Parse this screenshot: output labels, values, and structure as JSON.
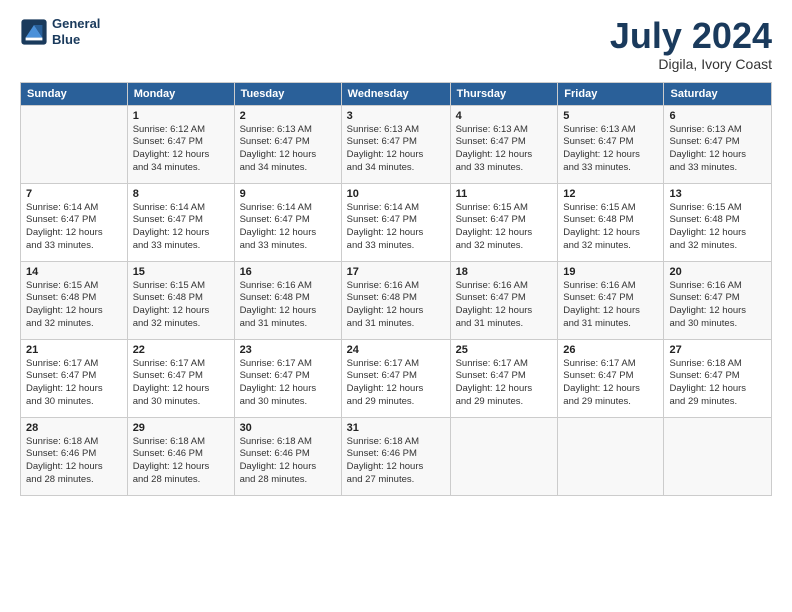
{
  "logo": {
    "line1": "General",
    "line2": "Blue"
  },
  "title": "July 2024",
  "subtitle": "Digila, Ivory Coast",
  "days_of_week": [
    "Sunday",
    "Monday",
    "Tuesday",
    "Wednesday",
    "Thursday",
    "Friday",
    "Saturday"
  ],
  "weeks": [
    [
      {
        "day": "",
        "info": ""
      },
      {
        "day": "1",
        "info": "Sunrise: 6:12 AM\nSunset: 6:47 PM\nDaylight: 12 hours\nand 34 minutes."
      },
      {
        "day": "2",
        "info": "Sunrise: 6:13 AM\nSunset: 6:47 PM\nDaylight: 12 hours\nand 34 minutes."
      },
      {
        "day": "3",
        "info": "Sunrise: 6:13 AM\nSunset: 6:47 PM\nDaylight: 12 hours\nand 34 minutes."
      },
      {
        "day": "4",
        "info": "Sunrise: 6:13 AM\nSunset: 6:47 PM\nDaylight: 12 hours\nand 33 minutes."
      },
      {
        "day": "5",
        "info": "Sunrise: 6:13 AM\nSunset: 6:47 PM\nDaylight: 12 hours\nand 33 minutes."
      },
      {
        "day": "6",
        "info": "Sunrise: 6:13 AM\nSunset: 6:47 PM\nDaylight: 12 hours\nand 33 minutes."
      }
    ],
    [
      {
        "day": "7",
        "info": "Sunrise: 6:14 AM\nSunset: 6:47 PM\nDaylight: 12 hours\nand 33 minutes."
      },
      {
        "day": "8",
        "info": "Sunrise: 6:14 AM\nSunset: 6:47 PM\nDaylight: 12 hours\nand 33 minutes."
      },
      {
        "day": "9",
        "info": "Sunrise: 6:14 AM\nSunset: 6:47 PM\nDaylight: 12 hours\nand 33 minutes."
      },
      {
        "day": "10",
        "info": "Sunrise: 6:14 AM\nSunset: 6:47 PM\nDaylight: 12 hours\nand 33 minutes."
      },
      {
        "day": "11",
        "info": "Sunrise: 6:15 AM\nSunset: 6:47 PM\nDaylight: 12 hours\nand 32 minutes."
      },
      {
        "day": "12",
        "info": "Sunrise: 6:15 AM\nSunset: 6:48 PM\nDaylight: 12 hours\nand 32 minutes."
      },
      {
        "day": "13",
        "info": "Sunrise: 6:15 AM\nSunset: 6:48 PM\nDaylight: 12 hours\nand 32 minutes."
      }
    ],
    [
      {
        "day": "14",
        "info": "Sunrise: 6:15 AM\nSunset: 6:48 PM\nDaylight: 12 hours\nand 32 minutes."
      },
      {
        "day": "15",
        "info": "Sunrise: 6:15 AM\nSunset: 6:48 PM\nDaylight: 12 hours\nand 32 minutes."
      },
      {
        "day": "16",
        "info": "Sunrise: 6:16 AM\nSunset: 6:48 PM\nDaylight: 12 hours\nand 31 minutes."
      },
      {
        "day": "17",
        "info": "Sunrise: 6:16 AM\nSunset: 6:48 PM\nDaylight: 12 hours\nand 31 minutes."
      },
      {
        "day": "18",
        "info": "Sunrise: 6:16 AM\nSunset: 6:47 PM\nDaylight: 12 hours\nand 31 minutes."
      },
      {
        "day": "19",
        "info": "Sunrise: 6:16 AM\nSunset: 6:47 PM\nDaylight: 12 hours\nand 31 minutes."
      },
      {
        "day": "20",
        "info": "Sunrise: 6:16 AM\nSunset: 6:47 PM\nDaylight: 12 hours\nand 30 minutes."
      }
    ],
    [
      {
        "day": "21",
        "info": "Sunrise: 6:17 AM\nSunset: 6:47 PM\nDaylight: 12 hours\nand 30 minutes."
      },
      {
        "day": "22",
        "info": "Sunrise: 6:17 AM\nSunset: 6:47 PM\nDaylight: 12 hours\nand 30 minutes."
      },
      {
        "day": "23",
        "info": "Sunrise: 6:17 AM\nSunset: 6:47 PM\nDaylight: 12 hours\nand 30 minutes."
      },
      {
        "day": "24",
        "info": "Sunrise: 6:17 AM\nSunset: 6:47 PM\nDaylight: 12 hours\nand 29 minutes."
      },
      {
        "day": "25",
        "info": "Sunrise: 6:17 AM\nSunset: 6:47 PM\nDaylight: 12 hours\nand 29 minutes."
      },
      {
        "day": "26",
        "info": "Sunrise: 6:17 AM\nSunset: 6:47 PM\nDaylight: 12 hours\nand 29 minutes."
      },
      {
        "day": "27",
        "info": "Sunrise: 6:18 AM\nSunset: 6:47 PM\nDaylight: 12 hours\nand 29 minutes."
      }
    ],
    [
      {
        "day": "28",
        "info": "Sunrise: 6:18 AM\nSunset: 6:46 PM\nDaylight: 12 hours\nand 28 minutes."
      },
      {
        "day": "29",
        "info": "Sunrise: 6:18 AM\nSunset: 6:46 PM\nDaylight: 12 hours\nand 28 minutes."
      },
      {
        "day": "30",
        "info": "Sunrise: 6:18 AM\nSunset: 6:46 PM\nDaylight: 12 hours\nand 28 minutes."
      },
      {
        "day": "31",
        "info": "Sunrise: 6:18 AM\nSunset: 6:46 PM\nDaylight: 12 hours\nand 27 minutes."
      },
      {
        "day": "",
        "info": ""
      },
      {
        "day": "",
        "info": ""
      },
      {
        "day": "",
        "info": ""
      }
    ]
  ]
}
